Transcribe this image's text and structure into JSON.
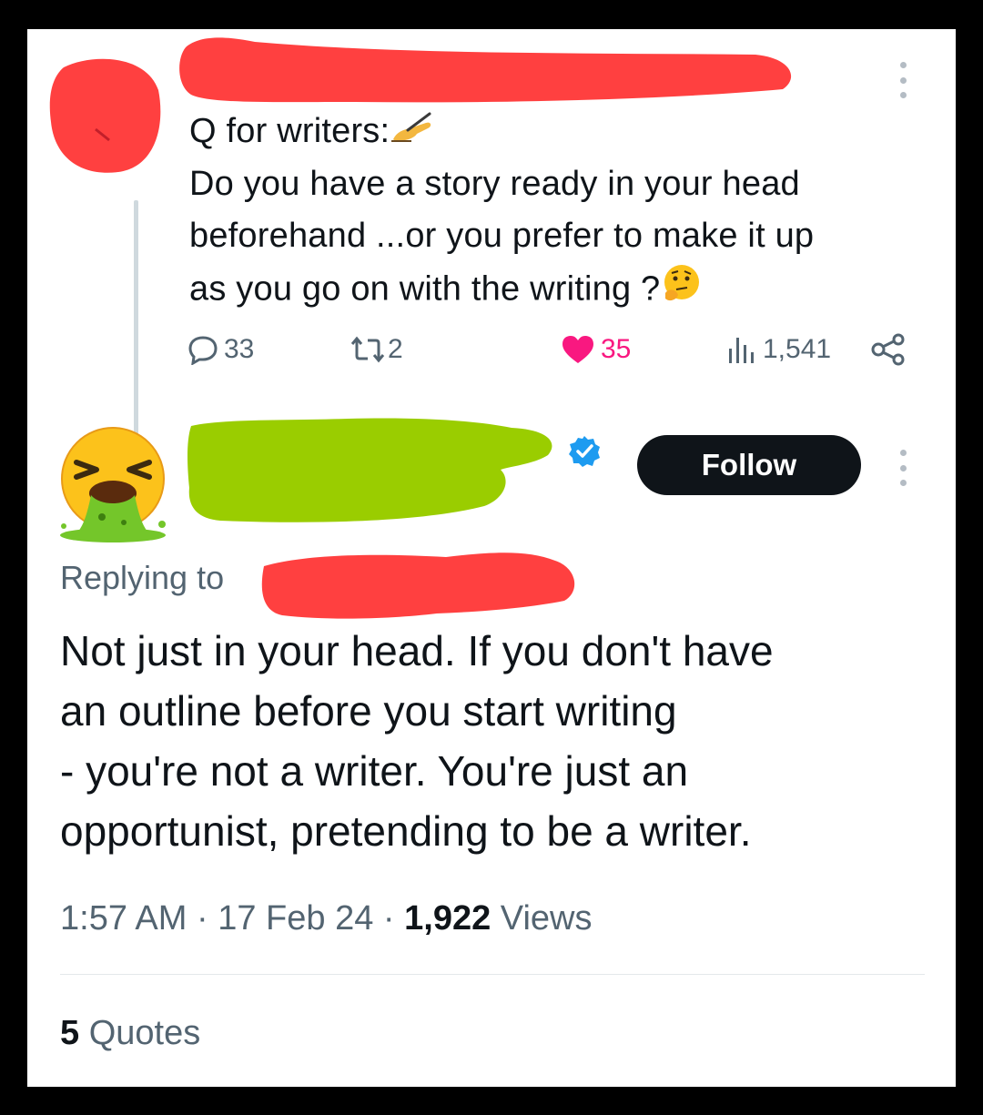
{
  "original_tweet": {
    "lines": [
      "Q for writers:",
      "Do you have a story ready in your head",
      "beforehand ...or you prefer to make it up",
      "as you go on with the writing ?"
    ],
    "line1_emoji": "writing-hand-emoji",
    "line4_emoji": "thinking-face-emoji",
    "stats": {
      "replies": "33",
      "retweets": "2",
      "likes": "35",
      "views": "1,541"
    }
  },
  "reply": {
    "follow_label": "Follow",
    "replying_to_label": "Replying to",
    "lines": [
      "Not just in your head. If you don't have",
      "an outline before you start writing",
      "- you're not a writer. You're just an",
      "opportunist, pretending to be a writer."
    ],
    "time": "1:57 AM",
    "date": "17 Feb 24",
    "views_count": "1,922",
    "views_label": "Views",
    "quotes_count": "5",
    "quotes_label": "Quotes",
    "avatar_emoji": "face-vomiting-emoji"
  },
  "colors": {
    "text": "#0f1419",
    "secondary": "#536471",
    "like": "#f91880",
    "verified": "#1d9bf0",
    "redaction_red": "#ff4040",
    "redaction_green": "#9acd00"
  }
}
